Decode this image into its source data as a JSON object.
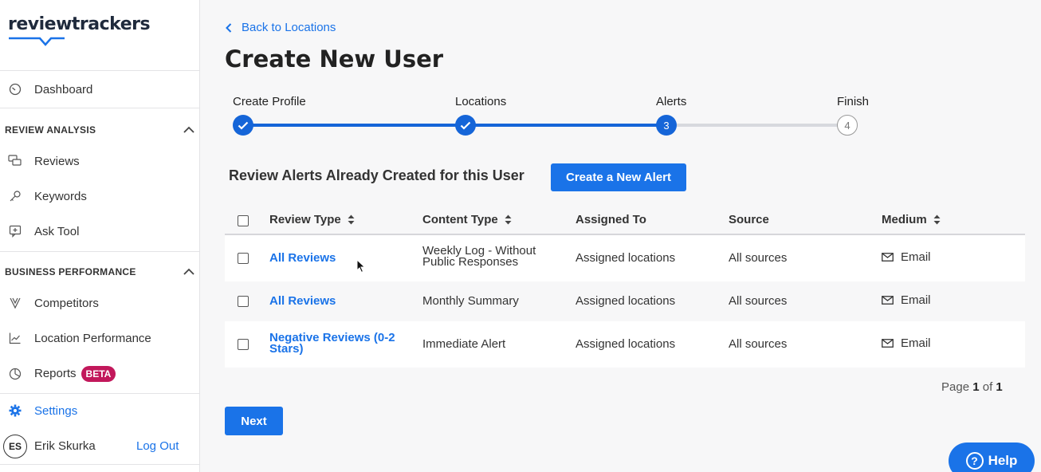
{
  "brand": {
    "name": "reviewtrackers"
  },
  "sidebar": {
    "dashboard": "Dashboard",
    "review_analysis": {
      "label": "REVIEW ANALYSIS",
      "items": [
        "Reviews",
        "Keywords",
        "Ask Tool"
      ]
    },
    "business_performance": {
      "label": "BUSINESS PERFORMANCE",
      "items": [
        "Competitors",
        "Location Performance",
        "Reports"
      ],
      "reports_badge": "BETA"
    },
    "settings": "Settings",
    "user": {
      "initials": "ES",
      "name": "Erik Skurka",
      "logout": "Log Out"
    }
  },
  "main": {
    "back_link": "Back to Locations",
    "title": "Create New User",
    "steps": [
      {
        "label": "Create Profile",
        "status": "done"
      },
      {
        "label": "Locations",
        "status": "done"
      },
      {
        "label": "Alerts",
        "status": "current",
        "number": "3"
      },
      {
        "label": "Finish",
        "status": "pending",
        "number": "4"
      }
    ],
    "alerts_heading": "Review Alerts Already Created for this User",
    "create_alert_button": "Create a New Alert",
    "table": {
      "headers": {
        "review_type": "Review Type",
        "content_type": "Content Type",
        "assigned_to": "Assigned To",
        "source": "Source",
        "medium": "Medium"
      },
      "rows": [
        {
          "review_type_1": "All Reviews",
          "review_type_2": "",
          "content_type_1": "Weekly Log - Without",
          "content_type_2": "Public Responses",
          "assigned_to": "Assigned locations",
          "source": "All sources",
          "medium": "Email"
        },
        {
          "review_type_1": "All Reviews",
          "review_type_2": "",
          "content_type_1": "Monthly Summary",
          "content_type_2": "",
          "assigned_to": "Assigned locations",
          "source": "All sources",
          "medium": "Email"
        },
        {
          "review_type_1": "Negative Reviews (0-2",
          "review_type_2": "Stars)",
          "content_type_1": "Immediate Alert",
          "content_type_2": "",
          "assigned_to": "Assigned locations",
          "source": "All sources",
          "medium": "Email"
        }
      ]
    },
    "pager": {
      "prefix": "Page",
      "current": "1",
      "of": "of",
      "total": "1"
    },
    "next_button": "Next",
    "help_button": "Help"
  },
  "colors": {
    "accent": "#1a73e8",
    "step_done": "#1565d8",
    "beta": "#c2185b"
  },
  "icons": [
    "chevron-left-icon",
    "dashboard-gauge-icon",
    "reviews-chat-icon",
    "key-icon",
    "ask-tool-icon",
    "competitors-icon",
    "chart-line-icon",
    "reports-pie-icon",
    "gear-icon",
    "chevron-up-icon",
    "check-icon",
    "sort-icon",
    "email-icon",
    "question-icon"
  ]
}
